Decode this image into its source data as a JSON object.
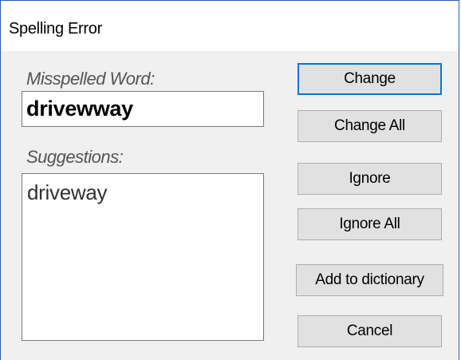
{
  "window": {
    "title": "Spelling Error"
  },
  "misspelled": {
    "label": "Misspelled Word:",
    "value": "drivewway"
  },
  "suggestions": {
    "label": "Suggestions:",
    "items": [
      "driveway"
    ]
  },
  "buttons": {
    "change": "Change",
    "change_all": "Change All",
    "ignore": "Ignore",
    "ignore_all": "Ignore All",
    "add_to_dictionary": "Add to dictionary",
    "cancel": "Cancel"
  },
  "colors": {
    "window_border": "#1f5fb0",
    "dialog_background": "#f0f0f0",
    "button_face": "#e1e1e1",
    "default_button_border": "#0078d7"
  }
}
